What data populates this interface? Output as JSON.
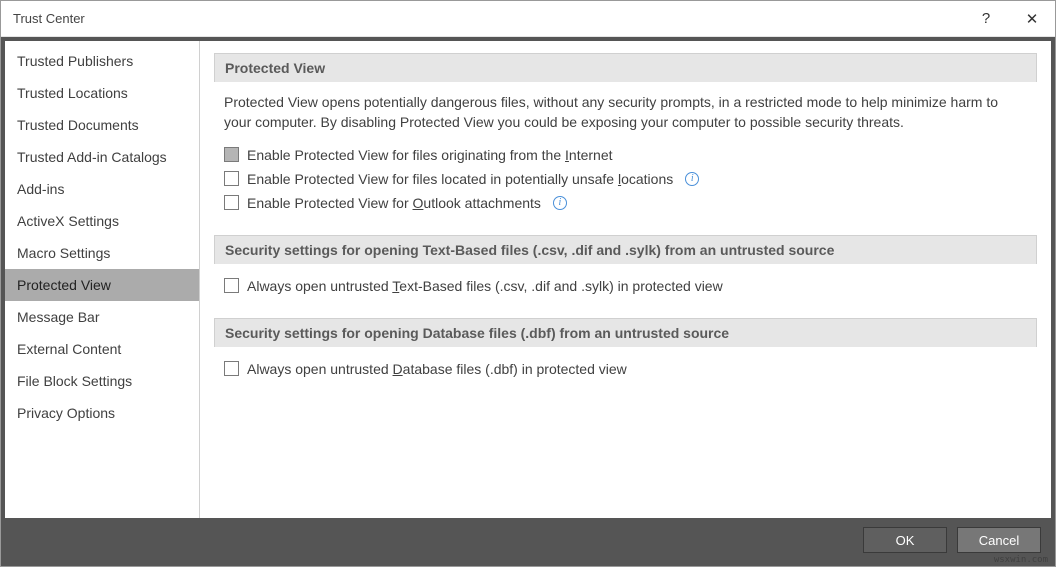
{
  "title": "Trust Center",
  "sidebar": {
    "items": [
      {
        "label": "Trusted Publishers"
      },
      {
        "label": "Trusted Locations"
      },
      {
        "label": "Trusted Documents"
      },
      {
        "label": "Trusted Add-in Catalogs"
      },
      {
        "label": "Add-ins"
      },
      {
        "label": "ActiveX Settings"
      },
      {
        "label": "Macro Settings"
      },
      {
        "label": "Protected View"
      },
      {
        "label": "Message Bar"
      },
      {
        "label": "External Content"
      },
      {
        "label": "File Block Settings"
      },
      {
        "label": "Privacy Options"
      }
    ],
    "selected_index": 7
  },
  "sections": {
    "protected_view": {
      "heading": "Protected View",
      "description": "Protected View opens potentially dangerous files, without any security prompts, in a restricted mode to help minimize harm to your computer. By disabling Protected View you could be exposing your computer to possible security threats.",
      "checkboxes": [
        {
          "label_html": "Enable Protected View for files originating from the <u>I</u>nternet",
          "checked": false,
          "shaded": true,
          "info": false
        },
        {
          "label_html": "Enable Protected View for files located in potentially unsafe <u>l</u>ocations",
          "checked": false,
          "shaded": false,
          "info": true
        },
        {
          "label_html": "Enable Protected View for <u>O</u>utlook attachments",
          "checked": false,
          "shaded": false,
          "info": true
        }
      ]
    },
    "text_based": {
      "heading": "Security settings for opening Text-Based files (.csv, .dif and .sylk) from an untrusted source",
      "checkboxes": [
        {
          "label_html": "Always open untrusted <u>T</u>ext-Based files (.csv, .dif and .sylk) in protected view",
          "checked": false,
          "shaded": false,
          "info": false
        }
      ]
    },
    "database": {
      "heading": "Security settings for opening Database files (.dbf) from an untrusted source",
      "checkboxes": [
        {
          "label_html": "Always open untrusted <u>D</u>atabase files (.dbf) in protected view",
          "checked": false,
          "shaded": false,
          "info": false
        }
      ]
    }
  },
  "footer": {
    "ok": "OK",
    "cancel": "Cancel"
  },
  "titlebar": {
    "help": "?",
    "close": "✕"
  },
  "watermark": "wsxwin.com"
}
